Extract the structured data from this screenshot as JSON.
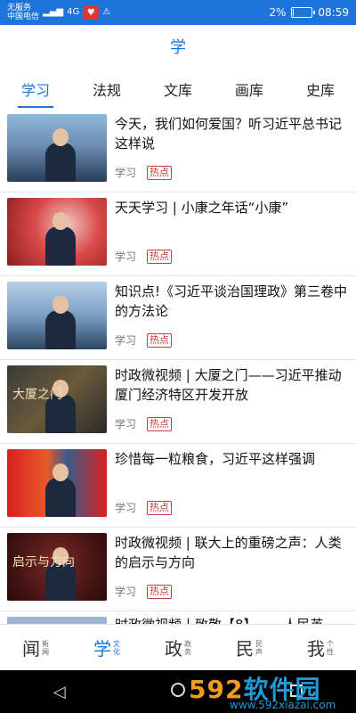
{
  "status_bar": {
    "carrier_line1": "无服务",
    "carrier_line2": "中国电信",
    "signal_text": "4G",
    "battery_percent": "2%",
    "battery_level": 0.02,
    "time": "08:59",
    "colors": {
      "background": "#1e73d9"
    }
  },
  "header": {
    "title": "学"
  },
  "tabs": [
    {
      "label": "学习",
      "active": true
    },
    {
      "label": "法规",
      "active": false
    },
    {
      "label": "文库",
      "active": false
    },
    {
      "label": "画库",
      "active": false
    },
    {
      "label": "史库",
      "active": false
    }
  ],
  "articles": [
    {
      "title": "今天，我们如何爱国？听习近平总书记这样说",
      "source": "学习",
      "tag": "热点"
    },
    {
      "title": "天天学习 | 小康之年话“小康”",
      "source": "学习",
      "tag": "热点"
    },
    {
      "title": "知识点!《习近平谈治国理政》第三卷中的方法论",
      "source": "学习",
      "tag": "热点"
    },
    {
      "title": "时政微视频 | 大厦之门——习近平推动厦门经济特区开发开放",
      "source": "学习",
      "tag": "热点",
      "thumb_text": "大厦之门"
    },
    {
      "title": "珍惜每一粒粮食，习近平这样强调",
      "source": "学习",
      "tag": "热点"
    },
    {
      "title": "时政微视频 | 联大上的重磅之声：人类的启示与方向",
      "source": "学习",
      "tag": "热点",
      "thumb_text": "启示与方向"
    }
  ],
  "partial_article": {
    "title": "时政微视频丨致敬【8】——人民英"
  },
  "bottom_nav": [
    {
      "big": "闻",
      "small1": "新",
      "small2": "闻",
      "active": false
    },
    {
      "big": "学",
      "small1": "文",
      "small2": "化",
      "active": true
    },
    {
      "big": "政",
      "small1": "政",
      "small2": "务",
      "active": false
    },
    {
      "big": "民",
      "small1": "民",
      "small2": "声",
      "active": false
    },
    {
      "big": "我",
      "small1": "个",
      "small2": "性",
      "active": false
    }
  ],
  "system_nav": {
    "back_icon": "◁"
  },
  "watermark": {
    "brand_num": "592",
    "brand_text": "软件园",
    "url": "www.592xiazai.com"
  },
  "colors": {
    "accent": "#1e73d9",
    "tag_red": "#c63d3d"
  }
}
